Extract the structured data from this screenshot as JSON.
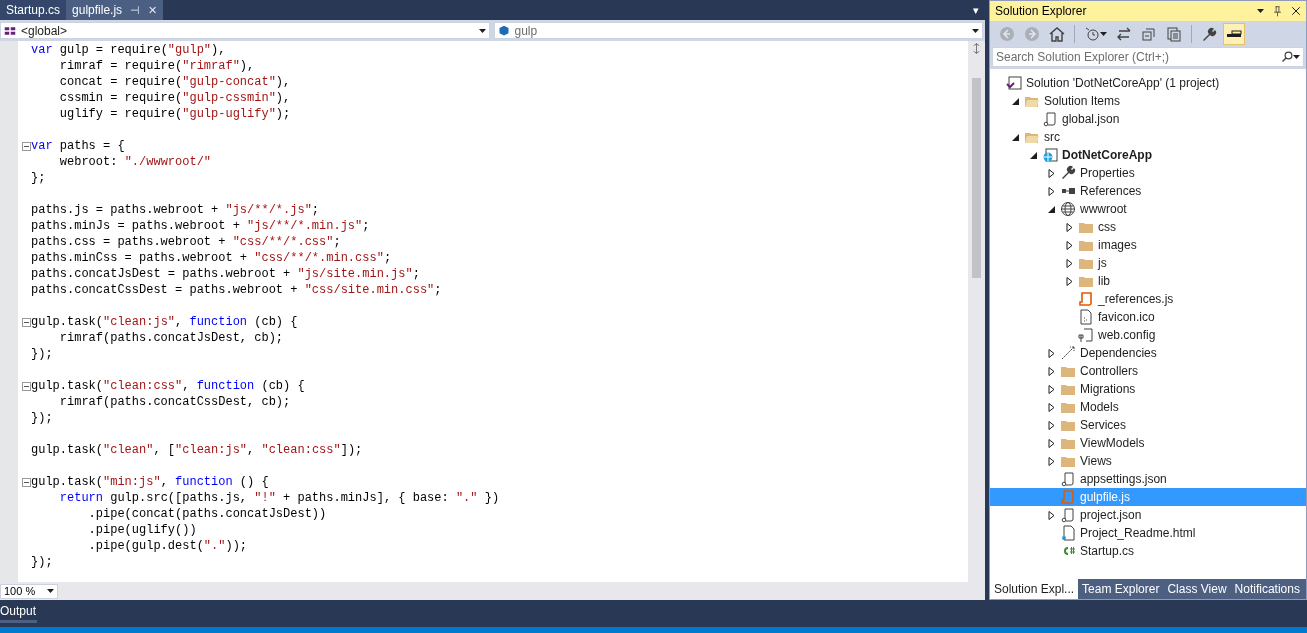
{
  "editor": {
    "tabs": [
      {
        "label": "Startup.cs",
        "selected": false
      },
      {
        "label": "gulpfile.js",
        "selected": true,
        "pin": "⊣",
        "close": "✕"
      }
    ],
    "tab_menu": "▾",
    "nav": [
      {
        "kind": "scope",
        "value": "<global>"
      },
      {
        "kind": "member",
        "value": "gulp"
      }
    ],
    "lines": [
      {
        "kind": "code",
        "tokens": [
          {
            "t": "var",
            "kind": "keyword"
          },
          {
            "t": " gulp = require(",
            "kind": "plain"
          },
          {
            "t": "\"gulp\"",
            "kind": "string"
          },
          {
            "t": "),",
            "kind": "plain"
          }
        ]
      },
      {
        "kind": "code",
        "tokens": [
          {
            "t": "    rimraf = require(",
            "kind": "plain"
          },
          {
            "t": "\"rimraf\"",
            "kind": "string"
          },
          {
            "t": "),",
            "kind": "plain"
          }
        ]
      },
      {
        "kind": "code",
        "tokens": [
          {
            "t": "    concat = require(",
            "kind": "plain"
          },
          {
            "t": "\"gulp-concat\"",
            "kind": "string"
          },
          {
            "t": "),",
            "kind": "plain"
          }
        ]
      },
      {
        "kind": "code",
        "tokens": [
          {
            "t": "    cssmin = require(",
            "kind": "plain"
          },
          {
            "t": "\"gulp-cssmin\"",
            "kind": "string"
          },
          {
            "t": "),",
            "kind": "plain"
          }
        ]
      },
      {
        "kind": "code",
        "tokens": [
          {
            "t": "    uglify = require(",
            "kind": "plain"
          },
          {
            "t": "\"gulp-uglify\"",
            "kind": "string"
          },
          {
            "t": ");",
            "kind": "plain"
          }
        ]
      },
      {
        "kind": "blank"
      },
      {
        "kind": "code",
        "fold": true,
        "tokens": [
          {
            "t": "var",
            "kind": "keyword"
          },
          {
            "t": " paths = {",
            "kind": "plain"
          }
        ]
      },
      {
        "kind": "code",
        "tokens": [
          {
            "t": "    webroot: ",
            "kind": "plain"
          },
          {
            "t": "\"./wwwroot/\"",
            "kind": "string"
          }
        ]
      },
      {
        "kind": "code",
        "tokens": [
          {
            "t": "};",
            "kind": "plain"
          }
        ]
      },
      {
        "kind": "blank"
      },
      {
        "kind": "code",
        "tokens": [
          {
            "t": "paths.js = paths.webroot + ",
            "kind": "plain"
          },
          {
            "t": "\"js/**/*.js\"",
            "kind": "string"
          },
          {
            "t": ";",
            "kind": "plain"
          }
        ]
      },
      {
        "kind": "code",
        "tokens": [
          {
            "t": "paths.minJs = paths.webroot + ",
            "kind": "plain"
          },
          {
            "t": "\"js/**/*.min.js\"",
            "kind": "string"
          },
          {
            "t": ";",
            "kind": "plain"
          }
        ]
      },
      {
        "kind": "code",
        "tokens": [
          {
            "t": "paths.css = paths.webroot + ",
            "kind": "plain"
          },
          {
            "t": "\"css/**/*.css\"",
            "kind": "string"
          },
          {
            "t": ";",
            "kind": "plain"
          }
        ]
      },
      {
        "kind": "code",
        "tokens": [
          {
            "t": "paths.minCss = paths.webroot + ",
            "kind": "plain"
          },
          {
            "t": "\"css/**/*.min.css\"",
            "kind": "string"
          },
          {
            "t": ";",
            "kind": "plain"
          }
        ]
      },
      {
        "kind": "code",
        "tokens": [
          {
            "t": "paths.concatJsDest = paths.webroot + ",
            "kind": "plain"
          },
          {
            "t": "\"js/site.min.js\"",
            "kind": "string"
          },
          {
            "t": ";",
            "kind": "plain"
          }
        ]
      },
      {
        "kind": "code",
        "tokens": [
          {
            "t": "paths.concatCssDest = paths.webroot + ",
            "kind": "plain"
          },
          {
            "t": "\"css/site.min.css\"",
            "kind": "string"
          },
          {
            "t": ";",
            "kind": "plain"
          }
        ]
      },
      {
        "kind": "blank"
      },
      {
        "kind": "code",
        "fold": true,
        "tokens": [
          {
            "t": "gulp.task(",
            "kind": "plain"
          },
          {
            "t": "\"clean:js\"",
            "kind": "string"
          },
          {
            "t": ", ",
            "kind": "plain"
          },
          {
            "t": "function",
            "kind": "keyword"
          },
          {
            "t": " (cb) {",
            "kind": "plain"
          }
        ]
      },
      {
        "kind": "code",
        "tokens": [
          {
            "t": "    rimraf(paths.concatJsDest, cb);",
            "kind": "plain"
          }
        ]
      },
      {
        "kind": "code",
        "tokens": [
          {
            "t": "});",
            "kind": "plain"
          }
        ]
      },
      {
        "kind": "blank"
      },
      {
        "kind": "code",
        "fold": true,
        "tokens": [
          {
            "t": "gulp.task(",
            "kind": "plain"
          },
          {
            "t": "\"clean:css\"",
            "kind": "string"
          },
          {
            "t": ", ",
            "kind": "plain"
          },
          {
            "t": "function",
            "kind": "keyword"
          },
          {
            "t": " (cb) {",
            "kind": "plain"
          }
        ]
      },
      {
        "kind": "code",
        "tokens": [
          {
            "t": "    rimraf(paths.concatCssDest, cb);",
            "kind": "plain"
          }
        ]
      },
      {
        "kind": "code",
        "tokens": [
          {
            "t": "});",
            "kind": "plain"
          }
        ]
      },
      {
        "kind": "blank"
      },
      {
        "kind": "code",
        "tokens": [
          {
            "t": "gulp.task(",
            "kind": "plain"
          },
          {
            "t": "\"clean\"",
            "kind": "string"
          },
          {
            "t": ", [",
            "kind": "plain"
          },
          {
            "t": "\"clean:js\"",
            "kind": "string"
          },
          {
            "t": ", ",
            "kind": "plain"
          },
          {
            "t": "\"clean:css\"",
            "kind": "string"
          },
          {
            "t": "]);",
            "kind": "plain"
          }
        ]
      },
      {
        "kind": "blank"
      },
      {
        "kind": "code",
        "fold": true,
        "tokens": [
          {
            "t": "gulp.task(",
            "kind": "plain"
          },
          {
            "t": "\"min:js\"",
            "kind": "string"
          },
          {
            "t": ", ",
            "kind": "plain"
          },
          {
            "t": "function",
            "kind": "keyword"
          },
          {
            "t": " () {",
            "kind": "plain"
          }
        ]
      },
      {
        "kind": "code",
        "tokens": [
          {
            "t": "    return",
            "kind": "keyword"
          },
          {
            "t": " gulp.src([paths.js, ",
            "kind": "plain"
          },
          {
            "t": "\"!\"",
            "kind": "string"
          },
          {
            "t": " + paths.minJs], { base: ",
            "kind": "plain"
          },
          {
            "t": "\".\"",
            "kind": "string"
          },
          {
            "t": " })",
            "kind": "plain"
          }
        ]
      },
      {
        "kind": "code",
        "tokens": [
          {
            "t": "        .pipe(concat(paths.concatJsDest))",
            "kind": "plain"
          }
        ]
      },
      {
        "kind": "code",
        "tokens": [
          {
            "t": "        .pipe(uglify())",
            "kind": "plain"
          }
        ]
      },
      {
        "kind": "code",
        "tokens": [
          {
            "t": "        .pipe(gulp.dest(",
            "kind": "plain"
          },
          {
            "t": "\".\"",
            "kind": "string"
          },
          {
            "t": "));",
            "kind": "plain"
          }
        ]
      },
      {
        "kind": "code",
        "tokens": [
          {
            "t": "});",
            "kind": "plain"
          }
        ]
      }
    ],
    "zoom": "100 %"
  },
  "solution_explorer": {
    "title": "Solution Explorer",
    "toolbar": [
      {
        "kind": "back",
        "disabled": true,
        "on": false
      },
      {
        "kind": "forward",
        "disabled": true,
        "on": false
      },
      {
        "kind": "home",
        "disabled": false,
        "on": false
      },
      {
        "kind": "history",
        "disabled": false,
        "on": false
      },
      {
        "kind": "sync",
        "disabled": false,
        "on": false
      },
      {
        "kind": "collapse",
        "disabled": false,
        "on": false
      },
      {
        "kind": "show-all",
        "disabled": false,
        "on": false
      },
      {
        "kind": "properties",
        "disabled": false,
        "on": false
      },
      {
        "kind": "preview",
        "disabled": false,
        "on": true
      }
    ],
    "search": {
      "placeholder": "Search Solution Explorer (Ctrl+;)"
    },
    "tree": [
      {
        "label": "Solution 'DotNetCoreApp' (1 project)",
        "kind": "solution",
        "selected": false,
        "children": [
          {
            "label": "Solution Items",
            "kind": "folder-open",
            "expanded": true,
            "selected": false,
            "children": [
              {
                "label": "global.json",
                "kind": "json",
                "selected": false
              }
            ]
          },
          {
            "label": "src",
            "kind": "folder-open",
            "expanded": true,
            "selected": false,
            "children": [
              {
                "label": "DotNetCoreApp",
                "kind": "project",
                "expanded": true,
                "selected": false,
                "children": [
                  {
                    "label": "Properties",
                    "kind": "properties",
                    "expanded": false,
                    "selected": false
                  },
                  {
                    "label": "References",
                    "kind": "references",
                    "expanded": false,
                    "selected": false
                  },
                  {
                    "label": "wwwroot",
                    "kind": "web",
                    "expanded": true,
                    "selected": false,
                    "children": [
                      {
                        "label": "css",
                        "kind": "folder",
                        "expanded": false,
                        "selected": false
                      },
                      {
                        "label": "images",
                        "kind": "folder",
                        "expanded": false,
                        "selected": false
                      },
                      {
                        "label": "js",
                        "kind": "folder",
                        "expanded": false,
                        "selected": false
                      },
                      {
                        "label": "lib",
                        "kind": "folder",
                        "expanded": false,
                        "selected": false
                      },
                      {
                        "label": "_references.js",
                        "kind": "js",
                        "selected": false
                      },
                      {
                        "label": "favicon.ico",
                        "kind": "ico",
                        "selected": false
                      },
                      {
                        "label": "web.config",
                        "kind": "config",
                        "selected": false
                      }
                    ]
                  },
                  {
                    "label": "Dependencies",
                    "kind": "dependencies",
                    "expanded": false,
                    "selected": false
                  },
                  {
                    "label": "Controllers",
                    "kind": "folder",
                    "expanded": false,
                    "selected": false
                  },
                  {
                    "label": "Migrations",
                    "kind": "folder",
                    "expanded": false,
                    "selected": false
                  },
                  {
                    "label": "Models",
                    "kind": "folder",
                    "expanded": false,
                    "selected": false
                  },
                  {
                    "label": "Services",
                    "kind": "folder",
                    "expanded": false,
                    "selected": false
                  },
                  {
                    "label": "ViewModels",
                    "kind": "folder",
                    "expanded": false,
                    "selected": false
                  },
                  {
                    "label": "Views",
                    "kind": "folder",
                    "expanded": false,
                    "selected": false
                  },
                  {
                    "label": "appsettings.json",
                    "kind": "json",
                    "selected": false
                  },
                  {
                    "label": "gulpfile.js",
                    "kind": "js",
                    "selected": true
                  },
                  {
                    "label": "project.json",
                    "kind": "json",
                    "expanded": false,
                    "selected": false
                  },
                  {
                    "label": "Project_Readme.html",
                    "kind": "html",
                    "selected": false
                  },
                  {
                    "label": "Startup.cs",
                    "kind": "cs",
                    "selected": false
                  }
                ]
              }
            ]
          }
        ]
      }
    ],
    "tabs": [
      {
        "label": "Solution Expl...",
        "selected": true
      },
      {
        "label": "Team Explorer",
        "selected": false
      },
      {
        "label": "Class View",
        "selected": false
      },
      {
        "label": "Notifications",
        "selected": false
      }
    ]
  },
  "bottom_panel": {
    "tabs": [
      {
        "label": "Output",
        "selected": true
      }
    ]
  }
}
